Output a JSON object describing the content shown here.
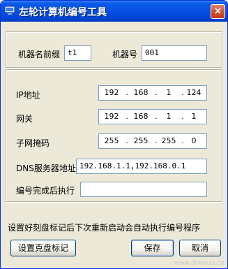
{
  "window": {
    "title": "左轮计算机编号工具",
    "close_glyph": "×"
  },
  "machine": {
    "prefix_label": "机器名前缀",
    "prefix_value": "t1",
    "number_label": "机器号",
    "number_value": "001"
  },
  "network": {
    "ip": {
      "label": "IP地址",
      "octets": [
        "192",
        "168",
        "1",
        "124"
      ]
    },
    "gateway": {
      "label": "网关",
      "octets": [
        "192",
        "168",
        "1",
        "1"
      ]
    },
    "mask": {
      "label": "子网掩码",
      "octets": [
        "255",
        "255",
        "255",
        "0"
      ]
    },
    "dns": {
      "label": "DNS服务器地址",
      "value": "192.168.1.1,192.168.0.1"
    },
    "post_run": {
      "label": "编号完成后执行",
      "value": ""
    }
  },
  "hint_text": "设置好刻盘标记后下次重新启动会自动执行编号程序",
  "buttons": {
    "set_disk_mark": "设置克盘标记",
    "save": "保存",
    "cancel": "取消"
  },
  "watermark": "www.downza.cn"
}
